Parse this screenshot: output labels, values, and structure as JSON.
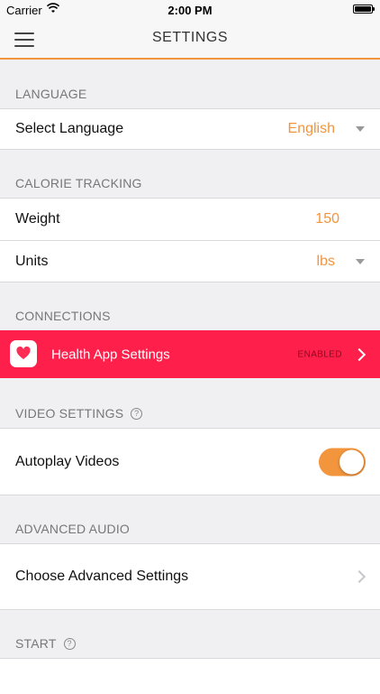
{
  "status_bar": {
    "carrier": "Carrier",
    "time": "2:00 PM"
  },
  "nav": {
    "title": "SETTINGS"
  },
  "sections": {
    "language": {
      "header": "LANGUAGE",
      "select_label": "Select Language",
      "select_value": "English"
    },
    "calorie": {
      "header": "CALORIE TRACKING",
      "weight_label": "Weight",
      "weight_value": "150",
      "units_label": "Units",
      "units_value": "lbs"
    },
    "connections": {
      "header": "CONNECTIONS",
      "health_label": "Health App Settings",
      "health_status": "ENABLED"
    },
    "video": {
      "header": "VIDEO SETTINGS",
      "help": "?",
      "autoplay_label": "Autoplay Videos",
      "autoplay_on": true
    },
    "audio": {
      "header": "ADVANCED AUDIO",
      "choose_label": "Choose Advanced Settings"
    },
    "start": {
      "header": "START",
      "help": "?"
    }
  },
  "colors": {
    "accent": "#f2953d",
    "health": "#ff1f4b"
  }
}
